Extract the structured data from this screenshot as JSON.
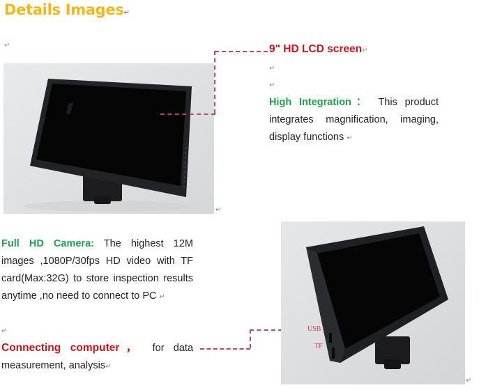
{
  "heading": {
    "title": "Details Images",
    "para_mark": "↵"
  },
  "para_marks": {
    "mark": "↵"
  },
  "section1": {
    "callout": "9\" HD LCD screen",
    "feature_head": "High Integration：",
    "feature_text": "This product integrates magnification, imaging, display functions",
    "image_alt": "9 inch HD LCD screen camera, front view"
  },
  "section2": {
    "camera_head": "Full HD Camera:",
    "camera_text": "The highest 12M images ,1080P/30fps HD video with TF card(Max:32G) to store inspection results anytime ,no need to connect to PC",
    "connect_head": "Connecting computer，",
    "connect_text": "for data measurement, analysis",
    "port_labels": {
      "usb": "USB",
      "tf": "TF"
    },
    "image_alt": "LCD screen camera, side view showing USB and TF ports"
  },
  "colors": {
    "title": "#f0b81a",
    "red_heading": "#d0121b",
    "green_heading": "#22a050",
    "connector": "#b84a62"
  }
}
